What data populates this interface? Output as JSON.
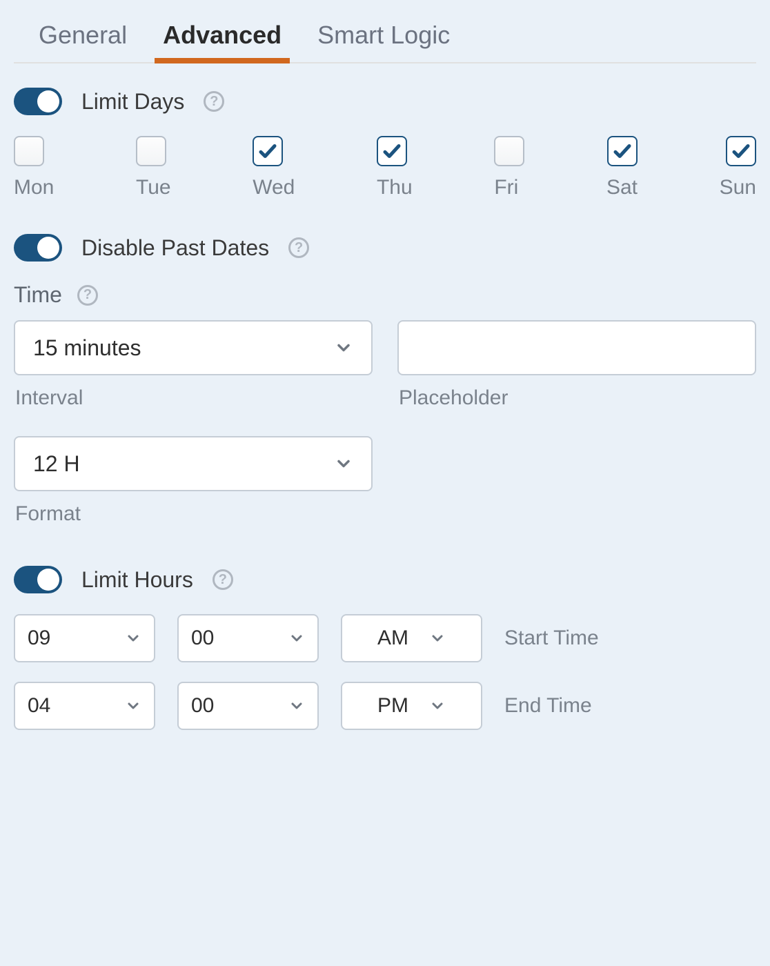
{
  "tabs": {
    "general": "General",
    "advanced": "Advanced",
    "smart_logic": "Smart Logic"
  },
  "limit_days": {
    "label": "Limit Days"
  },
  "days": [
    {
      "label": "Mon",
      "checked": false
    },
    {
      "label": "Tue",
      "checked": false
    },
    {
      "label": "Wed",
      "checked": true
    },
    {
      "label": "Thu",
      "checked": true
    },
    {
      "label": "Fri",
      "checked": false
    },
    {
      "label": "Sat",
      "checked": true
    },
    {
      "label": "Sun",
      "checked": true
    }
  ],
  "disable_past": {
    "label": "Disable Past Dates"
  },
  "time": {
    "heading": "Time",
    "interval_value": "15 minutes",
    "interval_caption": "Interval",
    "placeholder_value": "",
    "placeholder_caption": "Placeholder",
    "format_value": "12 H",
    "format_caption": "Format"
  },
  "limit_hours": {
    "label": "Limit Hours"
  },
  "start": {
    "hour": "09",
    "minute": "00",
    "ampm": "AM",
    "label": "Start Time"
  },
  "end": {
    "hour": "04",
    "minute": "00",
    "ampm": "PM",
    "label": "End Time"
  }
}
